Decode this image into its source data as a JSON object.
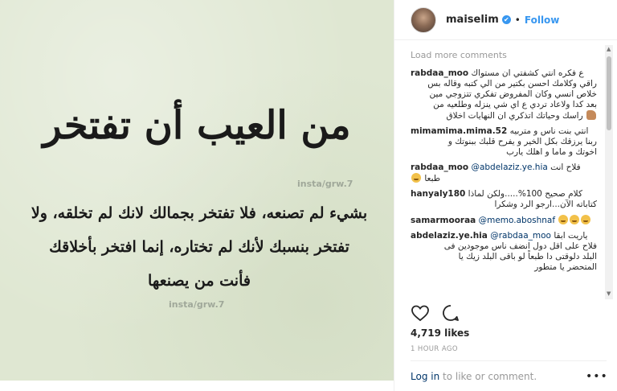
{
  "image": {
    "headline": "من العيب أن تفتخر",
    "watermark": "insta/grw.7",
    "line1": "بشيء لم تصنعه، فلا تفتخر بجمالك لانك لم تخلقه، ولا",
    "line2": "تفتخر بنسبك لأنك لم تختاره، إنما افتخر بأخلاقك",
    "line3": "فأنت من يصنعها"
  },
  "header": {
    "username": "maiselim",
    "verified_glyph": "✔",
    "separator": "•",
    "follow_label": "Follow"
  },
  "comments": {
    "load_more": "Load more comments",
    "items": [
      {
        "user": "rabdaa_moo",
        "first": "ع فكره انتي كشفتي ان مستواك",
        "rest": [
          "راقي وكلامك احسن بكتير من الي كتبه وقاله بس",
          "خلاص انسي وكان المفروض تفكري تتزوجي مين",
          "بعد كدا ولاعاد تردي ع اي شي ينزله وطلعيه من",
          "راسك وحياتك اتذكري ان النهايات اخلاق"
        ]
      },
      {
        "user": "mimamima.mima.52",
        "first": "انتي بنت ناس و متربيه",
        "rest": [
          "ربنا يرزقك بكل الخير و يفرح قلبك ببنوتك و",
          "اخوتك و ماما و اهلك يارب"
        ]
      },
      {
        "user": "rabdaa_moo",
        "mention": "@abdelaziz.ye.hia",
        "first": "فلاح انت",
        "rest": [
          "طبعا"
        ]
      },
      {
        "user": "hanyaly180",
        "first": "كلام صحيح 100%.....ولكن لماذا",
        "rest": [
          "كتاباته الآن...ارجو الرد وشكرا"
        ]
      },
      {
        "user": "samarmooraa",
        "mention": "@memo.aboshnaf"
      },
      {
        "user": "abdelaziz.ye.hia",
        "mention": "@rabdaa_moo",
        "first": "ياريت ابقا",
        "rest": [
          "فلاح على اقل دول انضف ناس موجودين فى",
          "البلد دلوقتى دا طبعاً لو باقى البلد زيك يا",
          "المتحضر يا متطور"
        ]
      }
    ]
  },
  "footer": {
    "likes": "4,719 likes",
    "time": "1 HOUR AGO",
    "login_link": "Log in",
    "login_rest": " to like or comment.",
    "more_glyph": "•••"
  },
  "colors": {
    "accent": "#3897f0",
    "link": "#003569",
    "muted": "#999999",
    "image_bg": "#dfe7d2"
  },
  "icons": [
    "heart-icon",
    "comment-icon",
    "verified-badge-icon",
    "more-options-icon",
    "emoji-icon",
    "flexed-biceps-icon"
  ]
}
